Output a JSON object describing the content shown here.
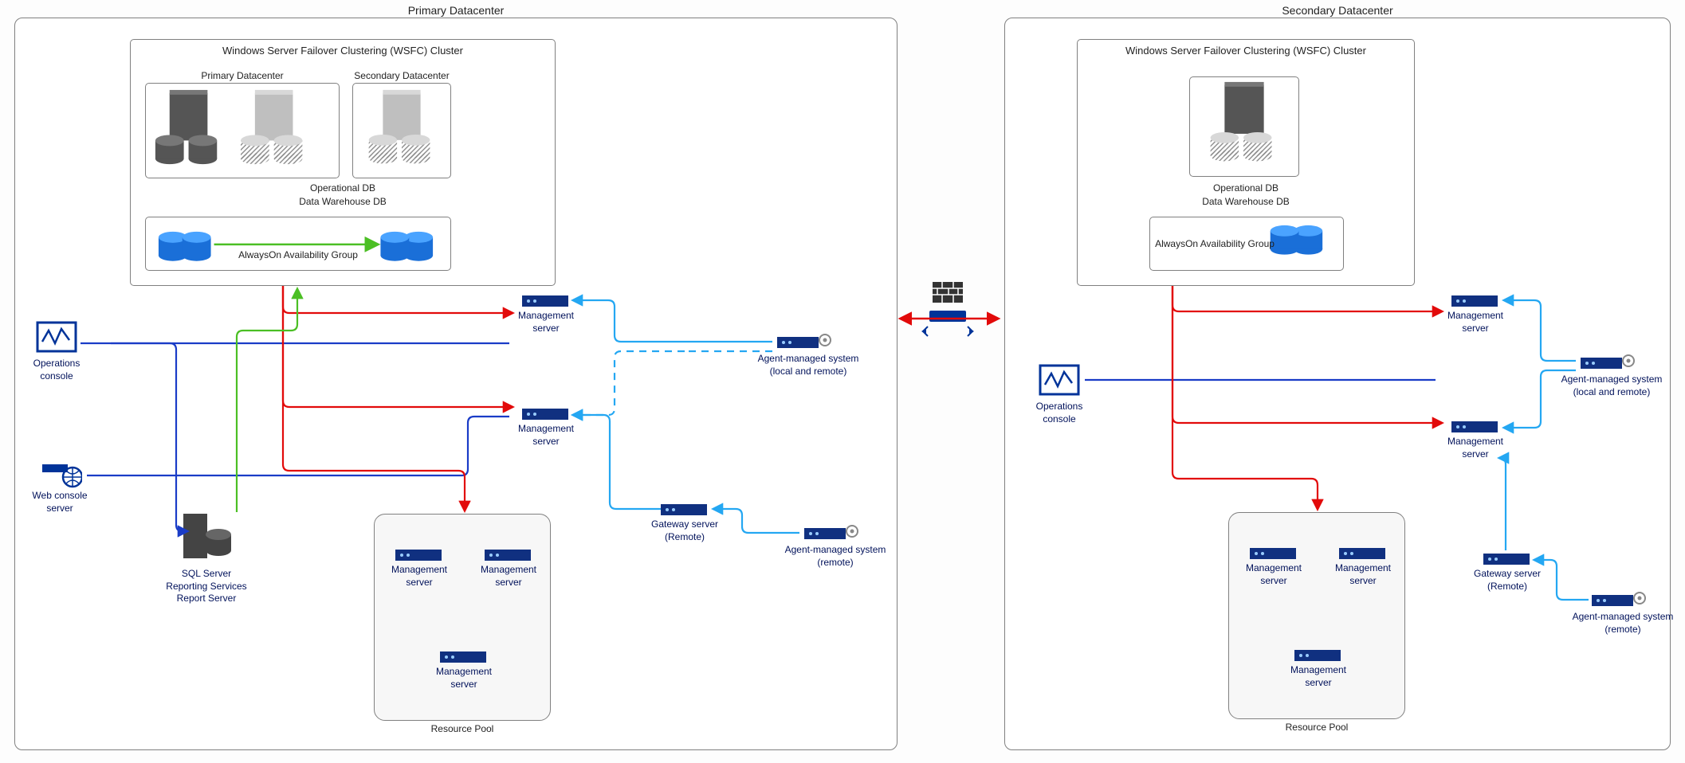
{
  "colors": {
    "blue_dark": "#003399",
    "blue_mid": "#1a3cc7",
    "blue_light": "#24a7f2",
    "red": "#e20a0a",
    "green": "#4bbf24",
    "gray_dark": "#555",
    "gray_hatch": "#a8a8a8"
  },
  "primary": {
    "title": "Primary Datacenter",
    "wsfc_title": "Windows Server Failover Clustering (WSFC) Cluster",
    "inner_primary": "Primary Datacenter",
    "inner_secondary": "Secondary Datacenter",
    "operational_db": "Operational DB",
    "data_warehouse_db": "Data Warehouse DB",
    "ag_label": "AlwaysOn Availability Group",
    "ops_console": "Operations console",
    "web_console": "Web console server",
    "sql_server": "SQL Server\nReporting Services\nReport Server",
    "mgmt_server": "Management server",
    "gateway": "Gateway server (Remote)",
    "agent_local": "Agent-managed system\n(local and remote)",
    "agent_remote": "Agent-managed system\n(remote)",
    "resource_pool": "Resource Pool"
  },
  "secondary": {
    "title": "Secondary Datacenter",
    "wsfc_title": "Windows Server Failover Clustering (WSFC) Cluster",
    "operational_db": "Operational DB",
    "data_warehouse_db": "Data Warehouse DB",
    "ag_label": "AlwaysOn Availability Group",
    "ops_console": "Operations console",
    "mgmt_server": "Management server",
    "gateway": "Gateway server (Remote)",
    "agent_local": "Agent-managed system\n(local and remote)",
    "agent_remote": "Agent-managed system\n(remote)",
    "resource_pool": "Resource Pool"
  }
}
